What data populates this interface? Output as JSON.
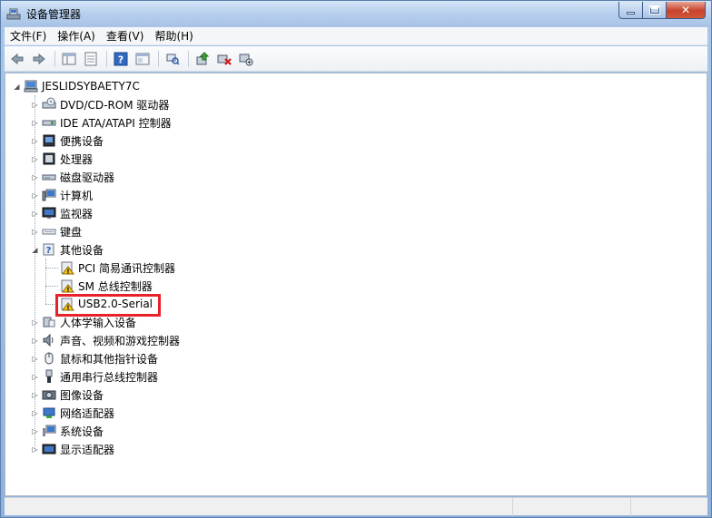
{
  "window": {
    "title": "设备管理器"
  },
  "menu": [
    {
      "label": "文件(F)"
    },
    {
      "label": "操作(A)"
    },
    {
      "label": "查看(V)"
    },
    {
      "label": "帮助(H)"
    }
  ],
  "toolbar": {
    "icons": [
      "back-icon",
      "forward-icon",
      "properties-pane-icon",
      "list-view-icon",
      "help-icon",
      "details-view-icon",
      "scan-hardware-icon",
      "update-driver-icon",
      "uninstall-icon",
      "disable-device-icon"
    ]
  },
  "tree": {
    "root": "JESLIDSYBAETY7C",
    "categories": [
      {
        "label": "DVD/CD-ROM 驱动器",
        "icon": "dvd-drive-icon"
      },
      {
        "label": "IDE ATA/ATAPI 控制器",
        "icon": "ide-controller-icon"
      },
      {
        "label": "便携设备",
        "icon": "portable-device-icon"
      },
      {
        "label": "处理器",
        "icon": "processor-icon"
      },
      {
        "label": "磁盘驱动器",
        "icon": "disk-drive-icon"
      },
      {
        "label": "计算机",
        "icon": "computer-icon"
      },
      {
        "label": "监视器",
        "icon": "monitor-icon"
      },
      {
        "label": "键盘",
        "icon": "keyboard-icon"
      },
      {
        "label": "其他设备",
        "icon": "unknown-device-icon",
        "expanded": true,
        "children": [
          {
            "label": "PCI 简易通讯控制器",
            "icon": "warning-device-icon"
          },
          {
            "label": "SM 总线控制器",
            "icon": "warning-device-icon"
          },
          {
            "label": "USB2.0-Serial",
            "icon": "warning-device-icon",
            "highlighted": true
          }
        ]
      },
      {
        "label": "人体学输入设备",
        "icon": "hid-icon"
      },
      {
        "label": "声音、视频和游戏控制器",
        "icon": "sound-icon"
      },
      {
        "label": "鼠标和其他指针设备",
        "icon": "mouse-icon"
      },
      {
        "label": "通用串行总线控制器",
        "icon": "usb-icon"
      },
      {
        "label": "图像设备",
        "icon": "imaging-device-icon"
      },
      {
        "label": "网络适配器",
        "icon": "network-adapter-icon"
      },
      {
        "label": "系统设备",
        "icon": "system-device-icon"
      },
      {
        "label": "显示适配器",
        "icon": "display-adapter-icon"
      }
    ]
  },
  "colors": {
    "highlight_border": "#e8222b",
    "warning_yellow": "#f5c518"
  }
}
